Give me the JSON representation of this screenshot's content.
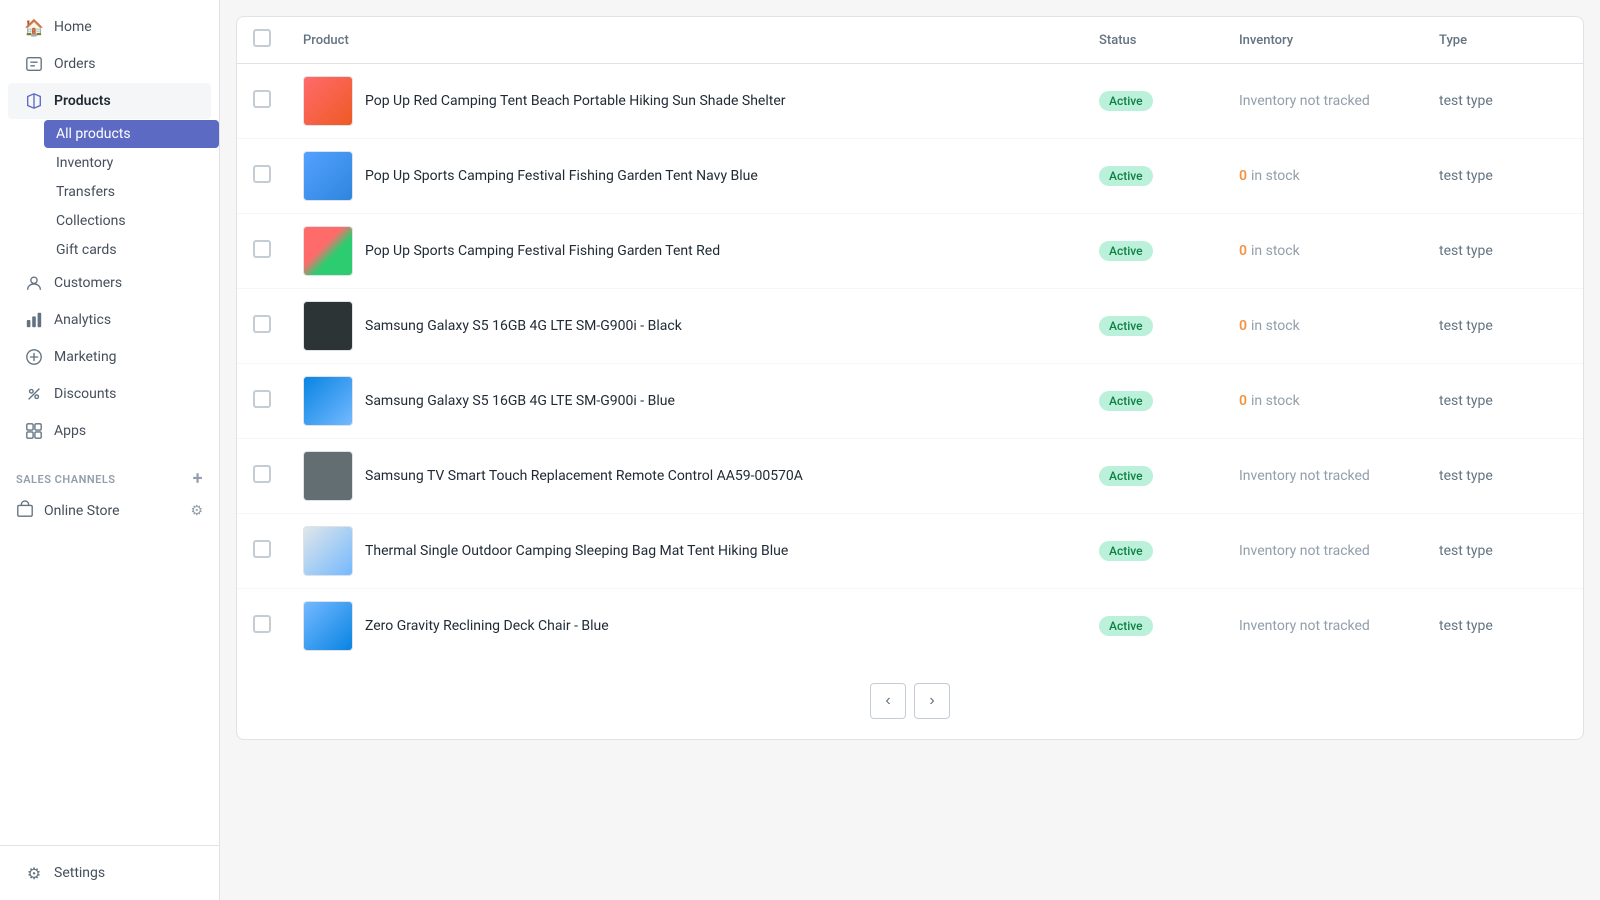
{
  "sidebar": {
    "nav": [
      {
        "id": "home",
        "label": "Home",
        "icon": "🏠"
      },
      {
        "id": "orders",
        "label": "Orders",
        "icon": "📦"
      },
      {
        "id": "products",
        "label": "Products",
        "icon": "🏷️",
        "active": true
      },
      {
        "id": "customers",
        "label": "Customers",
        "icon": "👤"
      },
      {
        "id": "analytics",
        "label": "Analytics",
        "icon": "📊"
      },
      {
        "id": "marketing",
        "label": "Marketing",
        "icon": "🎯"
      },
      {
        "id": "discounts",
        "label": "Discounts",
        "icon": "🏷"
      },
      {
        "id": "apps",
        "label": "Apps",
        "icon": "🧩"
      }
    ],
    "products_submenu": [
      {
        "id": "all-products",
        "label": "All products",
        "active": true
      },
      {
        "id": "inventory",
        "label": "Inventory"
      },
      {
        "id": "transfers",
        "label": "Transfers"
      },
      {
        "id": "collections",
        "label": "Collections"
      },
      {
        "id": "gift-cards",
        "label": "Gift cards"
      }
    ],
    "sales_channels_label": "SALES CHANNELS",
    "channels": [
      {
        "id": "online-store",
        "label": "Online Store"
      }
    ],
    "settings_label": "Settings"
  },
  "table": {
    "headers": {
      "product": "Product",
      "status": "Status",
      "inventory": "Inventory",
      "type": "Type"
    },
    "rows": [
      {
        "id": 1,
        "name": "Pop Up Red Camping Tent Beach Portable Hiking Sun Shade Shelter",
        "status": "Active",
        "inventory": "not_tracked",
        "inventory_label": "Inventory not tracked",
        "type": "test type",
        "img_class": "img-tent-red"
      },
      {
        "id": 2,
        "name": "Pop Up Sports Camping Festival Fishing Garden Tent Navy Blue",
        "status": "Active",
        "inventory": "zero",
        "inventory_count": "0",
        "inventory_label": " in stock",
        "type": "test type",
        "img_class": "img-tent-blue"
      },
      {
        "id": 3,
        "name": "Pop Up Sports Camping Festival Fishing Garden Tent Red",
        "status": "Active",
        "inventory": "zero",
        "inventory_count": "0",
        "inventory_label": " in stock",
        "type": "test type",
        "img_class": "img-tent-redgreen"
      },
      {
        "id": 4,
        "name": "Samsung Galaxy S5 16GB 4G LTE SM-G900i - Black",
        "status": "Active",
        "inventory": "zero",
        "inventory_count": "0",
        "inventory_label": " in stock",
        "type": "test type",
        "img_class": "img-phone-black"
      },
      {
        "id": 5,
        "name": "Samsung Galaxy S5 16GB 4G LTE SM-G900i - Blue",
        "status": "Active",
        "inventory": "zero",
        "inventory_count": "0",
        "inventory_label": " in stock",
        "type": "test type",
        "img_class": "img-phone-blue"
      },
      {
        "id": 6,
        "name": "Samsung TV Smart Touch Replacement Remote Control AA59-00570A",
        "status": "Active",
        "inventory": "not_tracked",
        "inventory_label": "Inventory not tracked",
        "type": "test type",
        "img_class": "img-remote"
      },
      {
        "id": 7,
        "name": "Thermal Single Outdoor Camping Sleeping Bag Mat Tent Hiking Blue",
        "status": "Active",
        "inventory": "not_tracked",
        "inventory_label": "Inventory not tracked",
        "type": "test type",
        "img_class": "img-sleeping-bag"
      },
      {
        "id": 8,
        "name": "Zero Gravity Reclining Deck Chair - Blue",
        "status": "Active",
        "inventory": "not_tracked",
        "inventory_label": "Inventory not tracked",
        "type": "test type",
        "img_class": "img-chair"
      }
    ]
  },
  "pagination": {
    "prev_label": "‹",
    "next_label": "›"
  }
}
